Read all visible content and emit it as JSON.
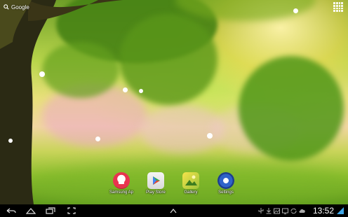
{
  "status": {
    "google_label": "Google",
    "time": "13:52"
  },
  "apps": [
    {
      "label": "Samsung Ap",
      "icon": "samsung-apps-icon"
    },
    {
      "label": "Play Store",
      "icon": "play-store-icon"
    },
    {
      "label": "Gallery",
      "icon": "gallery-icon"
    },
    {
      "label": "Settings",
      "icon": "settings-icon"
    }
  ],
  "nav": {
    "back": "back-icon",
    "home": "home-icon",
    "recent": "recent-apps-icon",
    "screenshot": "screenshot-icon",
    "up": "up-arrow-icon"
  },
  "colors": {
    "navbar": "#000000",
    "clock": "#ffffff",
    "signal": "#3fa7e8"
  }
}
